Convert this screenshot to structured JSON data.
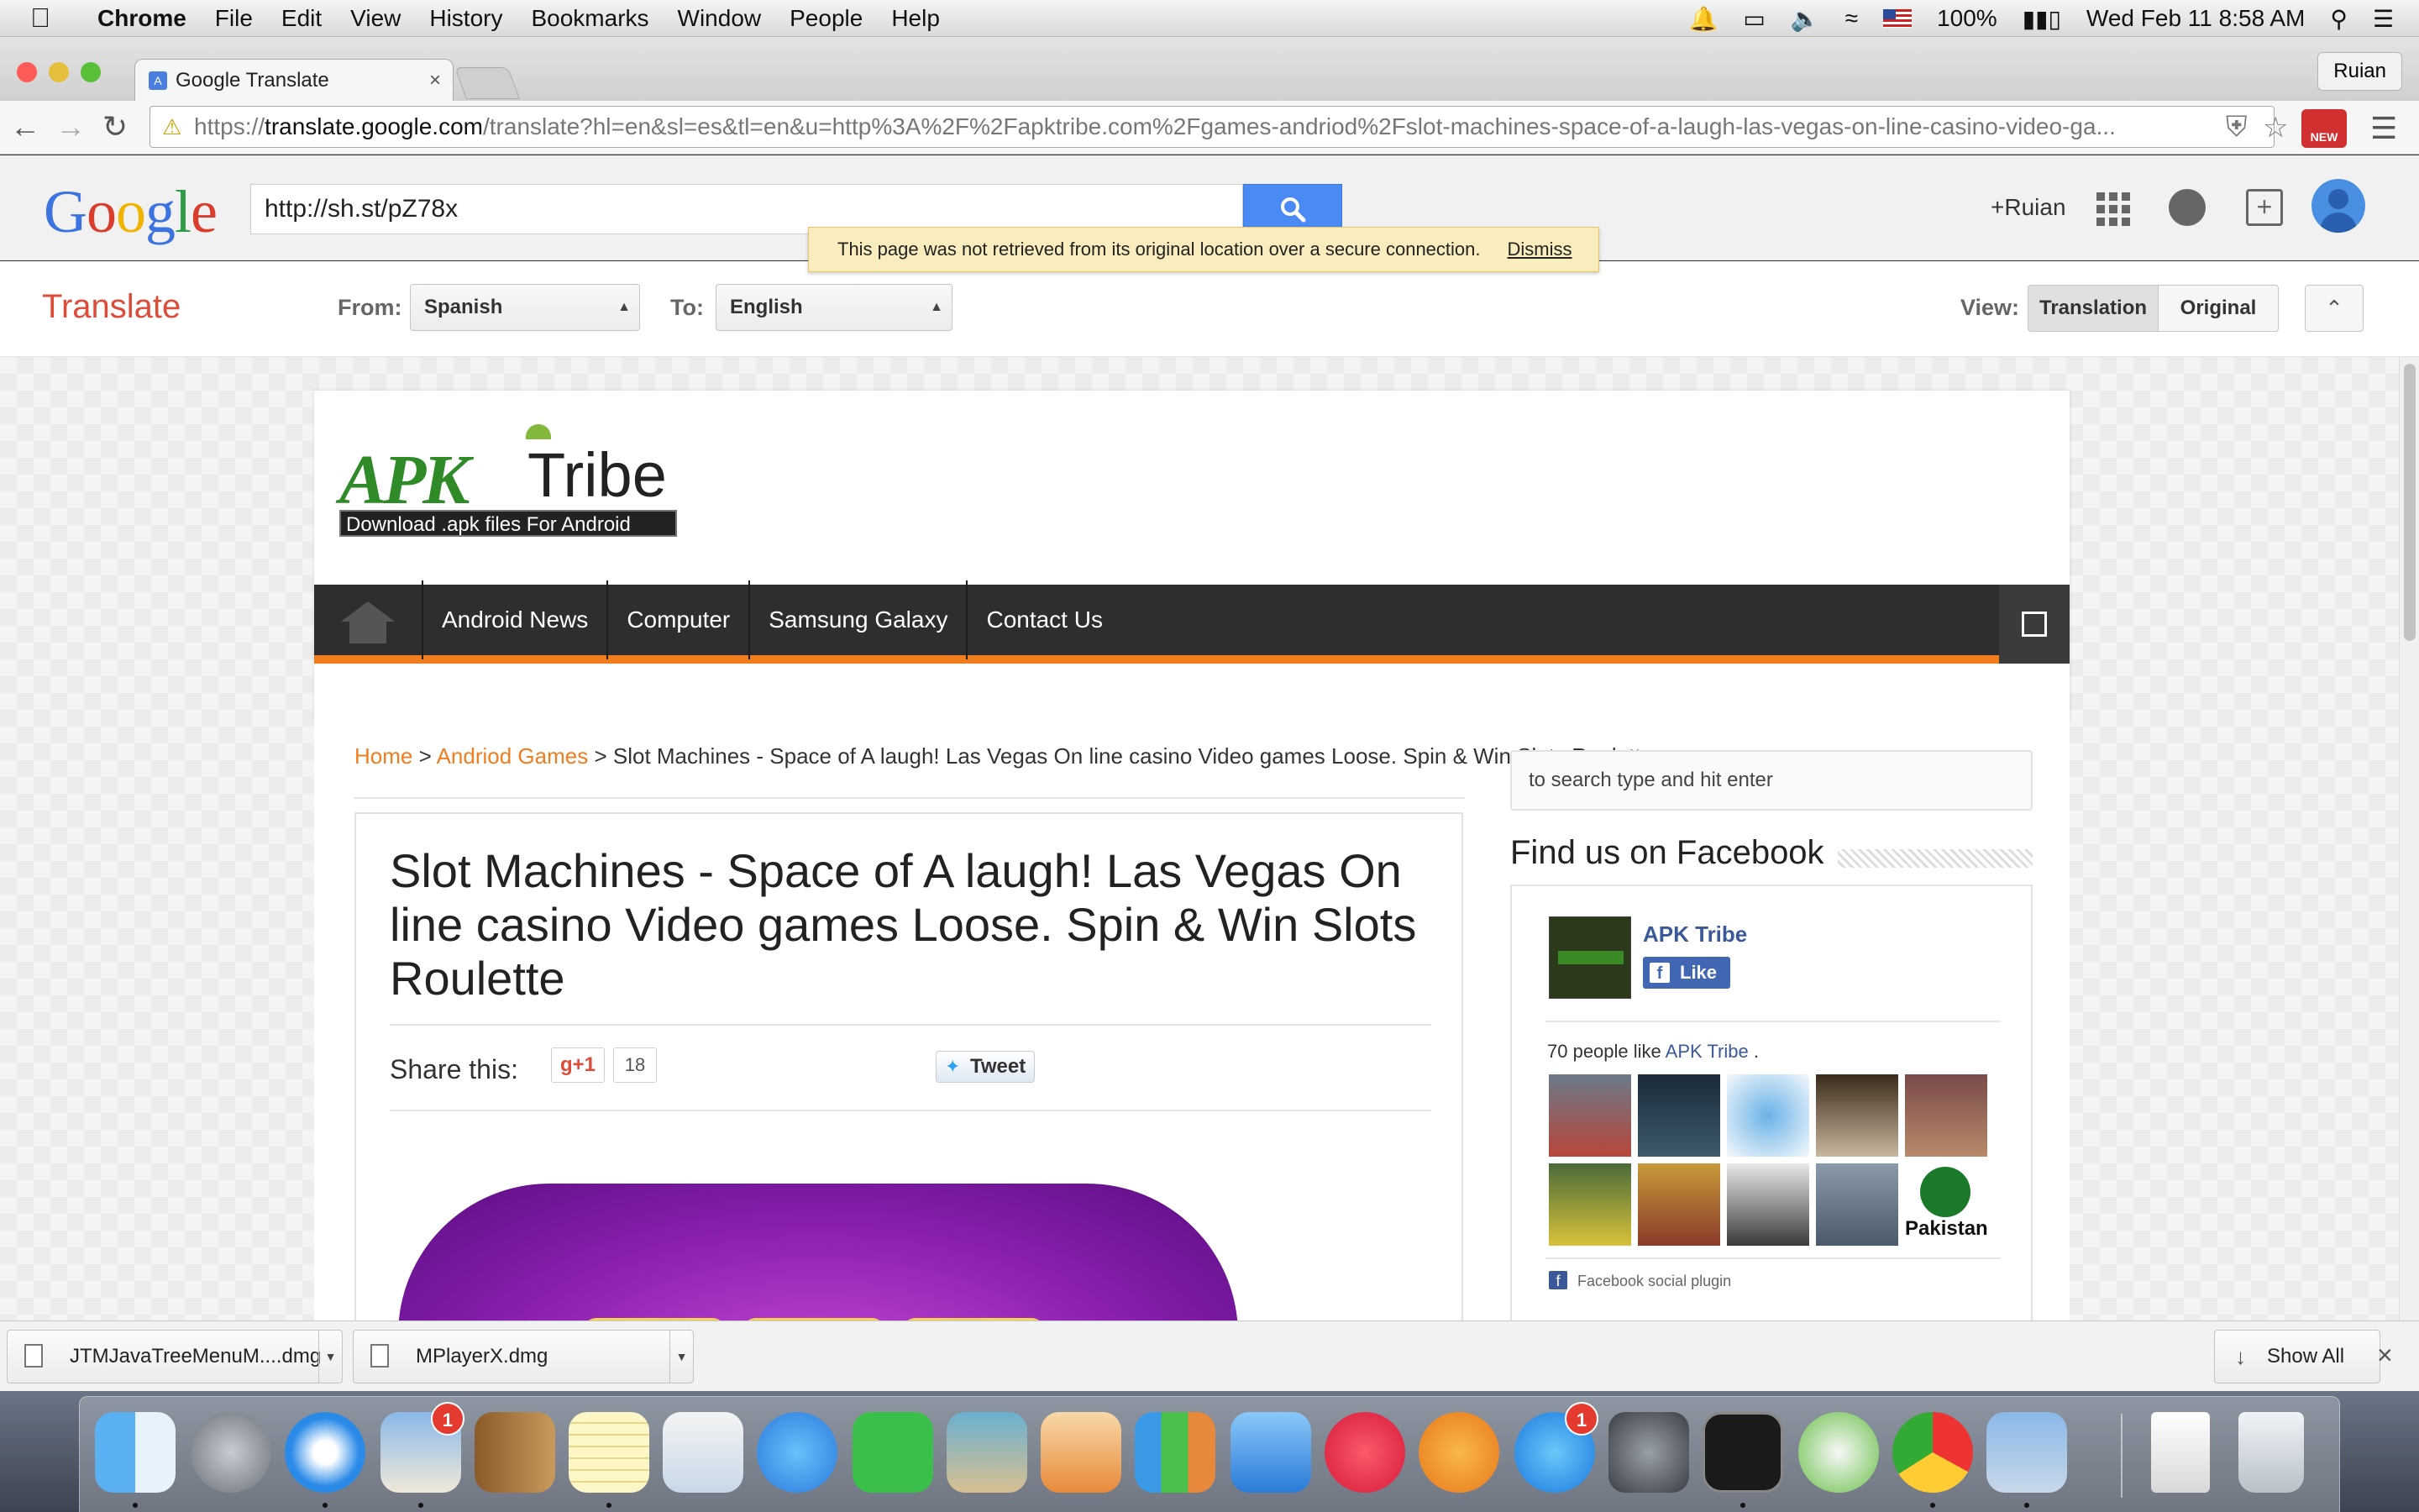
{
  "menubar": {
    "app": "Chrome",
    "menus": [
      "File",
      "Edit",
      "View",
      "History",
      "Bookmarks",
      "Window",
      "People",
      "Help"
    ],
    "battery": "100%",
    "clock": "Wed Feb 11  8:58 AM"
  },
  "browser": {
    "tab_title": "Google Translate",
    "profile": "Ruian",
    "url_scheme": "https://",
    "url_host": "translate.google.com",
    "url_rest": "/translate?hl=en&sl=es&tl=en&u=http%3A%2F%2Fapktribe.com%2Fgames-andriod%2Fslot-machines-space-of-a-laugh-las-vegas-on-line-casino-video-ga...",
    "extension_badge": "NEW"
  },
  "gt": {
    "logo_letters": [
      "G",
      "o",
      "o",
      "g",
      "l",
      "e"
    ],
    "search_value": "http://sh.st/pZ78x",
    "user_link": "+Ruian",
    "security_message": "This page was not retrieved from its original location over a secure connection.",
    "dismiss": "Dismiss",
    "title": "Translate",
    "from_label": "From:",
    "from_value": "Spanish",
    "to_label": "To:",
    "to_value": "English",
    "view_label": "View:",
    "view_translation": "Translation",
    "view_original": "Original"
  },
  "site": {
    "logo_apk": "APK",
    "logo_tribe": "Tribe",
    "logo_tagline": "Download .apk files For Android",
    "nav": [
      "Android News",
      "Computer",
      "Samsung Galaxy",
      "Contact Us"
    ],
    "breadcrumb_home": "Home",
    "breadcrumb_sep": " > ",
    "breadcrumb_category": "Andriod Games",
    "breadcrumb_current": "Slot Machines - Space of A laugh! Las Vegas On line casino Video games Loose. Spin & Win Slots Roulette",
    "article_title": "Slot Machines - Space of A laugh! Las Vegas On line casino Video games Loose. Spin & Win Slots Roulette",
    "share_label": "Share this:",
    "gplus_label": "g+1",
    "gplus_count": "18",
    "tweet_label": "Tweet",
    "search_placeholder": "to search type and hit enter",
    "fb_heading": "Find us on Facebook",
    "fb_page_name": "APK Tribe",
    "fb_like": "Like",
    "fb_count_prefix": "70 people like ",
    "fb_count_link": "APK Tribe",
    "fb_count_suffix": " .",
    "fb_face_overlay": "Pakistan",
    "fb_plugin": "Facebook social plugin"
  },
  "downloads": {
    "items": [
      "JTMJavaTreeMenuM....dmg",
      "MPlayerX.dmg"
    ],
    "show_all": "Show All"
  },
  "dock": {
    "badges": {
      "mail": "1",
      "appstore": "1"
    }
  }
}
